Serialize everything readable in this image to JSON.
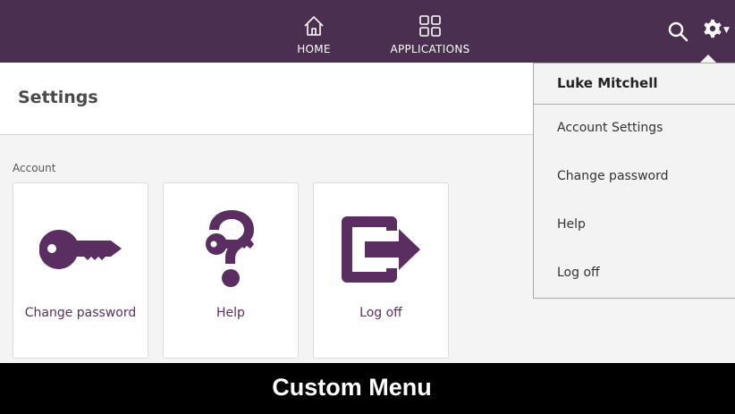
{
  "topbar": {
    "bg_color": "#4b2f50",
    "nav": [
      {
        "label": "HOME",
        "icon": "home-icon"
      },
      {
        "label": "APPLICATIONS",
        "icon": "grid-icon"
      }
    ],
    "search_icon": "search-icon",
    "settings_icon": "gear-icon"
  },
  "page": {
    "title": "Settings",
    "section_label": "Account",
    "tiles": [
      {
        "label": "Change password",
        "icon": "key-icon"
      },
      {
        "label": "Help",
        "icon": "help-icon"
      },
      {
        "label": "Log off",
        "icon": "logoff-icon"
      }
    ],
    "accent_color": "#5b2e62"
  },
  "dropdown": {
    "user_name": "Luke Mitchell",
    "items": [
      "Account Settings",
      "Change password",
      "Help",
      "Log off"
    ]
  },
  "caption": {
    "text": "Custom Menu"
  }
}
